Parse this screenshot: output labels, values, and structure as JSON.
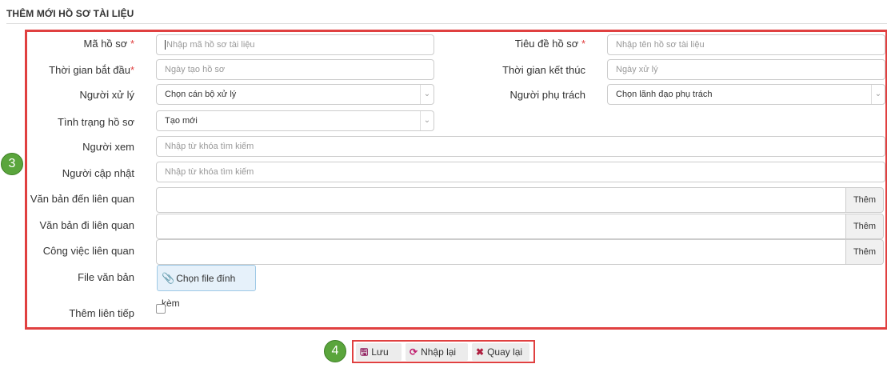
{
  "page_title": "THÊM MỚI HỒ SƠ TÀI LIỆU",
  "badges": {
    "form": "3",
    "actions": "4"
  },
  "fields": {
    "ma_ho_so": {
      "label": "Mã hồ sơ",
      "required": "*",
      "placeholder": "Nhập mã hồ sơ tài liệu"
    },
    "tieu_de": {
      "label": "Tiêu đề hồ sơ",
      "required": "*",
      "placeholder": "Nhập tên hồ sơ tài liệu"
    },
    "thoi_gian_bat_dau": {
      "label": "Thời gian bắt đầu",
      "required": "*",
      "placeholder": "Ngày tạo hồ sơ"
    },
    "thoi_gian_ket_thuc": {
      "label": "Thời gian kết thúc",
      "placeholder": "Ngày xử lý"
    },
    "nguoi_xu_ly": {
      "label": "Người xử lý",
      "value": "Chọn cán bộ xử lý"
    },
    "nguoi_phu_trach": {
      "label": "Người phụ trách",
      "value": "Chọn lãnh đạo phụ trách"
    },
    "tinh_trang": {
      "label": "Tình trạng hồ sơ",
      "value": "Tạo mới"
    },
    "nguoi_xem": {
      "label": "Người xem",
      "placeholder": "Nhập từ khóa tìm kiếm"
    },
    "nguoi_cap_nhat": {
      "label": "Người cập nhật",
      "placeholder": "Nhập từ khóa tìm kiếm"
    },
    "van_ban_den": {
      "label": "Văn bản đến liên quan",
      "button": "Thêm"
    },
    "van_ban_di": {
      "label": "Văn bản đi liên quan",
      "button": "Thêm"
    },
    "cong_viec": {
      "label": "Công việc liên quan",
      "button": "Thêm"
    },
    "file_van_ban": {
      "label": "File văn bản",
      "button": "Chọn file đính kèm",
      "icon": "paperclip-icon"
    },
    "them_lien_tiep": {
      "label": "Thêm liên tiếp",
      "checked": false
    }
  },
  "actions": {
    "save": {
      "label": "Lưu",
      "icon": "save-icon"
    },
    "reset": {
      "label": "Nhập lại",
      "icon": "refresh-icon"
    },
    "back": {
      "label": "Quay lại",
      "icon": "close-icon"
    }
  },
  "colors": {
    "highlight_border": "#e04040",
    "badge": "#5aa53c",
    "file_button_bg": "#e6f1fa"
  }
}
